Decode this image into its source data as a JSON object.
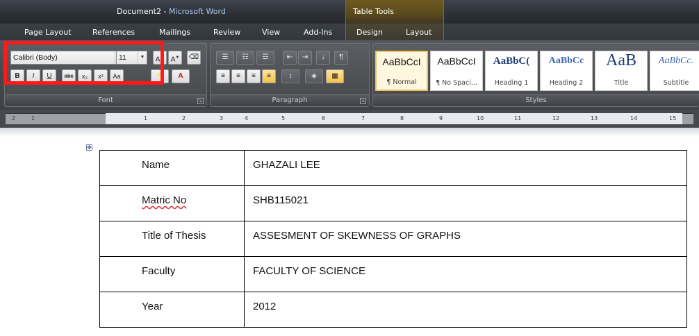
{
  "window": {
    "doc_name": "Document2",
    "separator": " - ",
    "app_name": "Microsoft Word",
    "contextual_group": "Table Tools"
  },
  "tabs": [
    "Page Layout",
    "References",
    "Mailings",
    "Review",
    "View",
    "Add-Ins",
    "Design",
    "Layout"
  ],
  "font": {
    "family": "Calibri (Body)",
    "size": "11",
    "group_label": "Font"
  },
  "paragraph": {
    "group_label": "Paragraph"
  },
  "styles": {
    "group_label": "Styles",
    "items": [
      {
        "preview": "AaBbCcI",
        "name": "¶ Normal"
      },
      {
        "preview": "AaBbCcI",
        "name": "¶ No Spaci..."
      },
      {
        "preview": "AaBbC(",
        "name": "Heading 1"
      },
      {
        "preview": "AaBbCc",
        "name": "Heading 2"
      },
      {
        "preview": "AaB",
        "name": "Title"
      },
      {
        "preview": "AaBbCc.",
        "name": "Subtitle"
      }
    ]
  },
  "ruler": {
    "numbers": [
      "2",
      "1",
      "1",
      "2",
      "3",
      "4",
      "5",
      "6",
      "7",
      "8",
      "9",
      "10",
      "11",
      "12",
      "13",
      "14",
      "15"
    ]
  },
  "table": {
    "rows": [
      {
        "label": "Name",
        "value": "GHAZALI LEE"
      },
      {
        "label": "Matric No",
        "value": "SHB115021"
      },
      {
        "label": "Title of Thesis",
        "value": "ASSESMENT OF SKEWNESS OF GRAPHS"
      },
      {
        "label": "Faculty",
        "value": "FACULTY OF SCIENCE"
      },
      {
        "label": "Year",
        "value": "2012"
      }
    ]
  },
  "colors": {
    "highlight": "#ff1a1a",
    "ribbon": "#47494c",
    "accent_title": "#a9c7ec"
  }
}
